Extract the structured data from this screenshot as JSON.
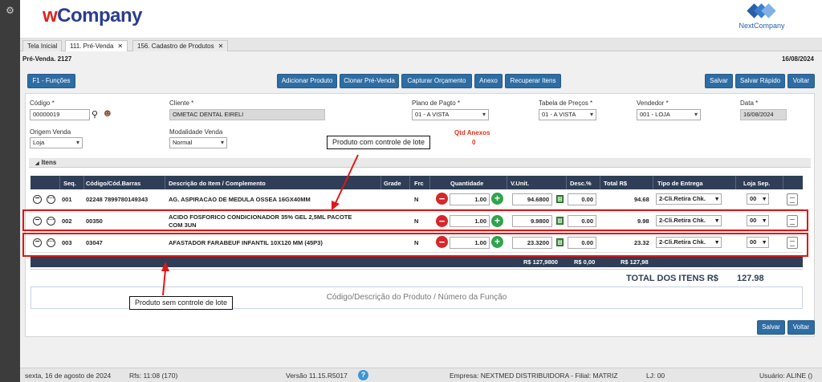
{
  "app": {
    "logo_w": "w",
    "logo_rest": "Company",
    "brand_right": "NextCompany"
  },
  "tabs": [
    {
      "label": "Tela Inicial"
    },
    {
      "label": "111. Pré-Venda"
    },
    {
      "label": "156. Cadastro de Produtos"
    }
  ],
  "page": {
    "title": "Pré-Venda. 2127",
    "date": "16/08/2024"
  },
  "toolbar": {
    "f1": "F1 - Funções",
    "adicionar": "Adicionar Produto",
    "clonar": "Clonar Pré-Venda",
    "capturar": "Capturar Orçamento",
    "anexo": "Anexo",
    "recuperar": "Recuperar Itens",
    "salvar": "Salvar",
    "salvar_rapido": "Salvar Rápido",
    "voltar": "Voltar"
  },
  "form": {
    "codigo_label": "Código *",
    "codigo_value": "00000019",
    "cliente_label": "Cliente *",
    "cliente_value": "OMETAC DENTAL EIRELI",
    "plano_label": "Plano de Pagto *",
    "plano_value": "01 - A VISTA",
    "tabela_label": "Tabela de Preços *",
    "tabela_value": "01 - A VISTA",
    "vendedor_label": "Vendedor *",
    "vendedor_value": "001 - LOJA",
    "data_label": "Data *",
    "data_value": "16/08/2024",
    "origem_label": "Origem Venda",
    "origem_value": "Loja",
    "modalidade_label": "Modalidade Venda",
    "modalidade_value": "Normal",
    "qtd_anexos_label": "Qtd Anexos",
    "qtd_anexos_value": "0"
  },
  "itens_title": "Itens",
  "columns": {
    "seq": "Seq.",
    "codigo": "Código/Cód.Barras",
    "descricao": "Descrição do Item / Complemento",
    "grade": "Grade",
    "frc": "Frc",
    "quantidade": "Quantidade",
    "vunit": "V.Unit.",
    "desc": "Desc.%",
    "total": "Total R$",
    "entrega": "Tipo de Entrega",
    "loja": "Loja Sep."
  },
  "rows": [
    {
      "seq": "001",
      "codigo": "02248 7899780149343",
      "descricao": "AG. ASPIRACAO DE MEDULA OSSEA 16GX40MM",
      "descricao2": "",
      "frc": "N",
      "qtd": "1.00",
      "vunit": "94.6800",
      "desc": "0.00",
      "total": "94.68",
      "entrega": "2-Cli.Retira Chk.",
      "loja": "00"
    },
    {
      "seq": "002",
      "codigo": "00350",
      "descricao": "ACIDO FOSFORICO CONDICIONADOR 35% GEL 2,5ML PACOTE",
      "descricao2": "COM 3UN",
      "frc": "N",
      "qtd": "1.00",
      "vunit": "9.9800",
      "desc": "0.00",
      "total": "9.98",
      "entrega": "2-Cli.Retira Chk.",
      "loja": "00"
    },
    {
      "seq": "003",
      "codigo": "03047",
      "descricao": "AFASTADOR FARABEUF INFANTIL 10X120 MM (45P3)",
      "descricao2": "",
      "frc": "N",
      "qtd": "1.00",
      "vunit": "23.3200",
      "desc": "0.00",
      "total": "23.32",
      "entrega": "2-Cli.Retira Chk.",
      "loja": "00"
    }
  ],
  "totals": {
    "vunit": "R$ 127,9800",
    "desc": "R$ 0,00",
    "total": "R$ 127,98",
    "label": "TOTAL DOS ITENS R$",
    "value": "127.98"
  },
  "search_placeholder": "Código/Descrição do Produto / Número da Função",
  "callouts": {
    "lote": "Produto com controle de lote",
    "sem_lote": "Produto sem controle de lote"
  },
  "footer": {
    "date": "sexta, 16 de agosto de 2024",
    "rfs": "Rfs: 11:08 (170)",
    "versao": "Versão 11.15.R5017",
    "empresa": "Empresa: NEXTMED DISTRIBUIDORA - Filial: MATRIZ",
    "lj": "LJ: 00",
    "usuario": "Usuário: ALINE ()"
  },
  "colors": {
    "primary": "#2e6da4",
    "header_dark": "#2f3e56",
    "red": "#e01616"
  }
}
